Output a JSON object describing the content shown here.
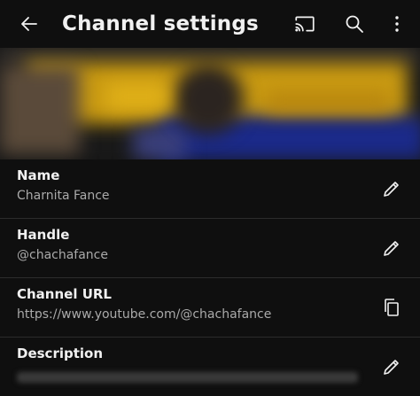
{
  "header": {
    "title": "Channel settings",
    "back_icon": "arrow-left-icon",
    "cast_icon": "cast-icon",
    "search_icon": "search-icon",
    "more_icon": "more-vertical-icon"
  },
  "fields": [
    {
      "label": "Name",
      "value": "Charnita Fance",
      "action_icon": "pencil-icon"
    },
    {
      "label": "Handle",
      "value": "@chachafance",
      "action_icon": "pencil-icon"
    },
    {
      "label": "Channel URL",
      "value": "https://www.youtube.com/@chachafance",
      "action_icon": "copy-icon"
    },
    {
      "label": "Description",
      "value": "",
      "action_icon": "pencil-icon"
    }
  ],
  "colors": {
    "background": "#0f0f0f",
    "text_primary": "#f1f1f1",
    "text_secondary": "#aaaaaa",
    "divider": "#2c2c2c",
    "banner_yellow": "#d1a00f",
    "banner_blue": "#1b2a8a"
  }
}
